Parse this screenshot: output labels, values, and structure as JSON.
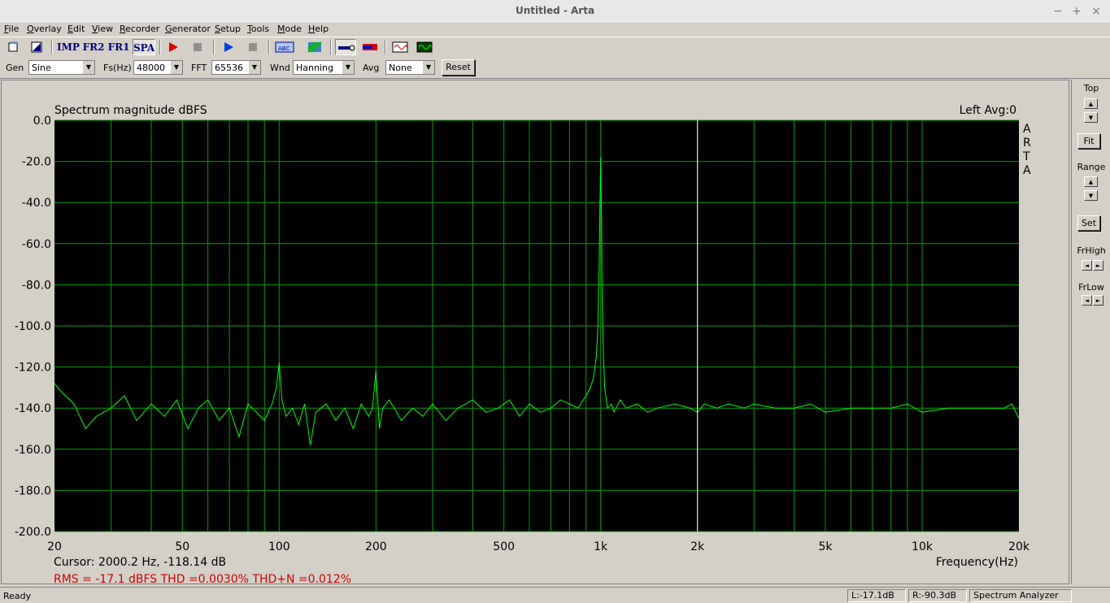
{
  "window": {
    "title": "Untitled - Arta",
    "minimize": "−",
    "maximize": "+",
    "close": "×"
  },
  "menu": [
    "File",
    "Overlay",
    "Edit",
    "View",
    "Recorder",
    "Generator",
    "Setup",
    "Tools",
    "Mode",
    "Help"
  ],
  "toolbar": {
    "imp": "IMP",
    "fr2": "FR2",
    "fr1": "FR1",
    "spa": "SPA"
  },
  "controls": {
    "gen_label": "Gen",
    "gen_value": "Sine",
    "fs_label": "Fs(Hz)",
    "fs_value": "48000",
    "fft_label": "FFT",
    "fft_value": "65536",
    "wnd_label": "Wnd",
    "wnd_value": "Hanning",
    "avg_label": "Avg",
    "avg_value": "None",
    "reset_label": "Reset"
  },
  "plot": {
    "title": "Spectrum magnitude dBFS",
    "channel_info": "Left  Avg:0",
    "side_logo": [
      "A",
      "R",
      "T",
      "A"
    ],
    "cursor_text": "Cursor:  2000.2 Hz, -118.14 dB",
    "measurements": "RMS =  -17.1 dBFS   THD =0.0030%   THD+N =0.012%",
    "xlabel": "Frequency(Hz)",
    "grid_color": "#00a000",
    "trace_color": "#00ff00",
    "cursor_line_color": "#ffffff",
    "measurement_color": "#cc0000"
  },
  "right_panel": {
    "top": "Top",
    "fit": "Fit",
    "range": "Range",
    "set": "Set",
    "frhigh": "FrHigh",
    "frlow": "FrLow"
  },
  "status": {
    "ready": "Ready",
    "left_level": "L:-17.1dB",
    "right_level": "R:-90.3dB",
    "mode": "Spectrum Analyzer"
  },
  "chart_data": {
    "type": "line",
    "title": "Spectrum magnitude dBFS",
    "xlabel": "Frequency(Hz)",
    "ylabel": "",
    "x_scale": "log",
    "xlim": [
      20,
      20000
    ],
    "ylim": [
      -200,
      0
    ],
    "grid": true,
    "x_ticks": [
      20,
      50,
      100,
      200,
      500,
      1000,
      2000,
      5000,
      10000,
      20000
    ],
    "x_tick_labels": [
      "20",
      "50",
      "100",
      "200",
      "500",
      "1k",
      "2k",
      "5k",
      "10k",
      "20k"
    ],
    "y_ticks": [
      0,
      -20,
      -40,
      -60,
      -80,
      -100,
      -120,
      -140,
      -160,
      -180,
      -200
    ],
    "y_tick_labels": [
      "0.0",
      "-20.0",
      "-40.0",
      "-60.0",
      "-80.0",
      "-100.0",
      "-120.0",
      "-140.0",
      "-160.0",
      "-180.0",
      "-200.0"
    ],
    "cursor_x": 2000.2,
    "series": [
      {
        "x": [
          20,
          21,
          23,
          25,
          27,
          30,
          33,
          36,
          40,
          44,
          48,
          52,
          56,
          60,
          65,
          70,
          75,
          80,
          85,
          90,
          95,
          98,
          100,
          102,
          105,
          110,
          115,
          120,
          125,
          130,
          140,
          150,
          160,
          170,
          180,
          190,
          195,
          200,
          205,
          210,
          220,
          240,
          260,
          280,
          300,
          330,
          360,
          400,
          440,
          480,
          520,
          560,
          600,
          650,
          700,
          750,
          800,
          850,
          900,
          930,
          950,
          970,
          980,
          990,
          995,
          1000,
          1005,
          1010,
          1020,
          1030,
          1050,
          1080,
          1100,
          1150,
          1200,
          1300,
          1400,
          1500,
          1700,
          1900,
          2000,
          2100,
          2300,
          2500,
          2800,
          3000,
          3500,
          4000,
          4500,
          5000,
          6000,
          7000,
          8000,
          9000,
          10000,
          12000,
          14000,
          16000,
          18000,
          19000,
          20000
        ],
        "y": [
          -128,
          -132,
          -138,
          -150,
          -144,
          -140,
          -134,
          -146,
          -138,
          -144,
          -136,
          -150,
          -140,
          -136,
          -146,
          -140,
          -154,
          -138,
          -142,
          -146,
          -138,
          -130,
          -118,
          -136,
          -144,
          -140,
          -148,
          -138,
          -158,
          -142,
          -138,
          -146,
          -140,
          -150,
          -138,
          -144,
          -140,
          -122,
          -150,
          -140,
          -136,
          -146,
          -140,
          -144,
          -138,
          -146,
          -140,
          -136,
          -142,
          -140,
          -136,
          -144,
          -138,
          -142,
          -140,
          -136,
          -138,
          -140,
          -134,
          -130,
          -125,
          -115,
          -100,
          -70,
          -40,
          -18,
          -40,
          -85,
          -115,
          -130,
          -140,
          -138,
          -142,
          -136,
          -140,
          -138,
          -142,
          -140,
          -138,
          -140,
          -142,
          -138,
          -140,
          -138,
          -140,
          -138,
          -140,
          -140,
          -138,
          -142,
          -140,
          -140,
          -140,
          -138,
          -142,
          -140,
          -140,
          -140,
          -140,
          -138,
          -145
        ]
      }
    ]
  }
}
